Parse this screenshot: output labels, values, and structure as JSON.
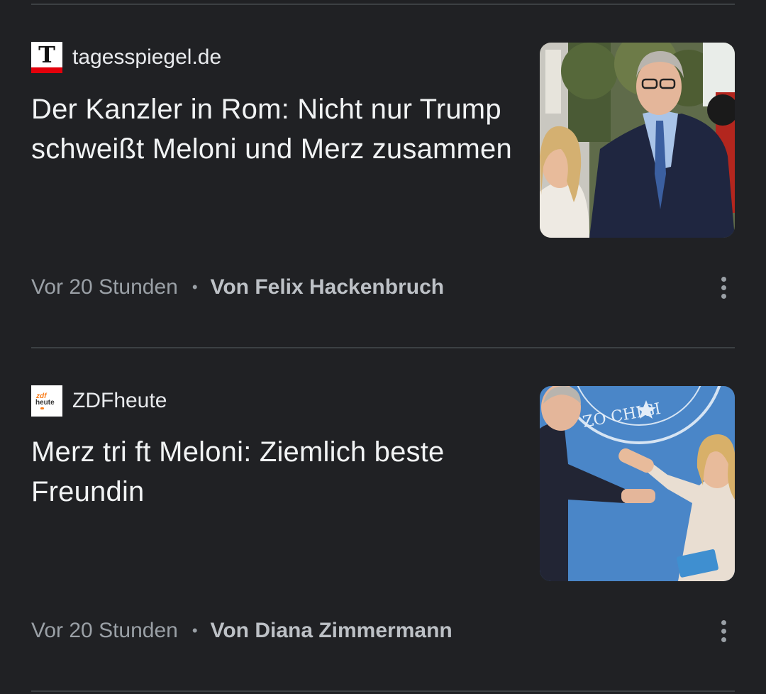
{
  "articles": [
    {
      "source": {
        "name": "tagesspiegel.de",
        "logo_letter": "T"
      },
      "headline": "Der Kanzler in Rom: Nicht nur Trump schweißt Meloni und Merz zusammen",
      "time": "Vor 20 Stunden",
      "separator": "•",
      "author": "Von Felix Hackenbruch",
      "more_icon": "more-vert-icon"
    },
    {
      "source": {
        "name": "ZDFheute",
        "logo_top": "zdf",
        "logo_bottom": "heute"
      },
      "headline": "Merz tri ft Meloni: Ziemlich beste Freundin",
      "time": "Vor 20 Stunden",
      "separator": "•",
      "author": "Von Diana Zimmermann",
      "more_icon": "more-vert-icon"
    }
  ],
  "thumb_text": {
    "seal_text": "ZO CHIGI"
  },
  "colors": {
    "background": "#202124",
    "divider": "#3c4043",
    "headline": "#f1f3f4",
    "meta_time": "#9aa0a6",
    "meta_author": "#bdc1c6",
    "tagesspiegel_red": "#e3000b",
    "zdf_orange": "#fa7d19"
  }
}
